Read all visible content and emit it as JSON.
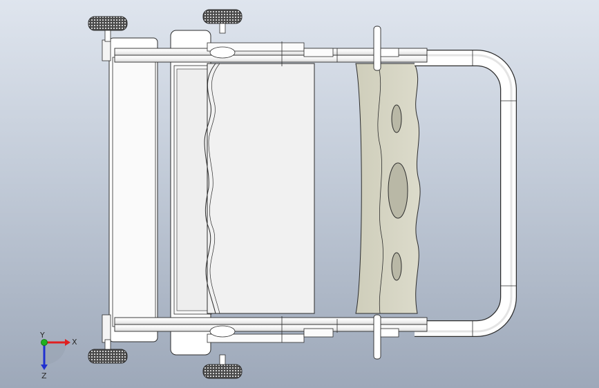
{
  "viewport": {
    "background_top": "#dfe5ee",
    "background_bottom": "#9da8b9"
  },
  "colors": {
    "edge": "#2b2b2b",
    "part_white": "#ffffff",
    "panel_grey": "#f1f1f1",
    "plate_tan": "#d3d2c1",
    "wheel_dark": "#3a3a3a",
    "axis_x": "#e02020",
    "axis_y": "#20b020",
    "axis_z": "#2030d0"
  },
  "triad": {
    "x_label": "X",
    "y_label": "Y",
    "z_label": "Z"
  },
  "model": {
    "icon": "stroller-top-view-model"
  }
}
